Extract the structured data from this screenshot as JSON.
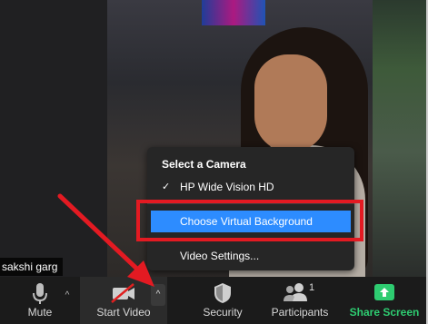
{
  "participant": {
    "name": "sakshi garg"
  },
  "camera_menu": {
    "heading": "Select a Camera",
    "items": [
      {
        "label": "HP Wide Vision HD",
        "checked": true
      },
      {
        "label": "Choose Virtual Background",
        "selected": true
      },
      {
        "label": "Video Settings..."
      }
    ],
    "check_glyph": "✓"
  },
  "toolbar": {
    "mute": "Mute",
    "start_video": "Start Video",
    "security": "Security",
    "participants": "Participants",
    "participants_count": "1",
    "share_screen": "Share Screen",
    "caret_glyph": "^"
  },
  "colors": {
    "accent_blue": "#2d8cff",
    "highlight_red": "#e31a22",
    "share_green": "#2ecc71",
    "video_off_red": "#e02020"
  },
  "icons": [
    "microphone-icon",
    "video-camera-off-icon",
    "shield-icon",
    "people-icon",
    "share-screen-icon",
    "checkmark-icon",
    "chevron-up-icon"
  ]
}
